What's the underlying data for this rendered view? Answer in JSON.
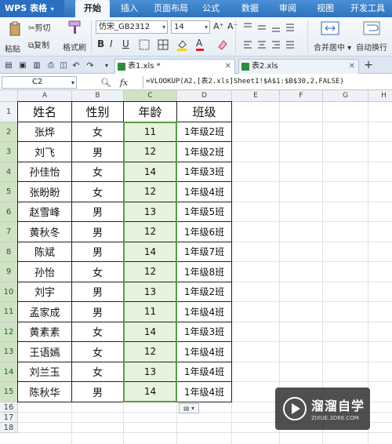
{
  "menubar": {
    "app_name": "WPS 表格",
    "tabs": [
      "开始",
      "插入",
      "页面布局",
      "公式",
      "数据",
      "审阅",
      "视图",
      "开发工具"
    ],
    "active_tab": "开始"
  },
  "ribbon": {
    "paste": "粘贴",
    "cut": "剪切",
    "copy": "复制",
    "format_painter": "格式刷",
    "font_name": "仿宋_GB2312",
    "font_size": "14",
    "bold": "B",
    "italic": "I",
    "underline": "U",
    "font_color": "A",
    "grow_font": "A⁺",
    "shrink_font": "A⁻",
    "merge_center": "合并居中",
    "wrap_text": "自动换行"
  },
  "file_tabs": [
    {
      "label": "表1.xls *",
      "active": true
    },
    {
      "label": "表2.xls",
      "active": false
    }
  ],
  "formula_bar": {
    "cell_ref": "C2",
    "fx": "fx",
    "formula": "=VLOOKUP(A2,[表2.xls]Sheet1!$A$1:$B$30,2,FALSE)"
  },
  "sheet": {
    "columns": [
      "A",
      "B",
      "C",
      "D",
      "E",
      "F",
      "G",
      "H"
    ],
    "rows": [
      "1",
      "2",
      "3",
      "4",
      "5",
      "6",
      "7",
      "8",
      "9",
      "10",
      "11",
      "12",
      "13",
      "14",
      "15",
      "16",
      "17",
      "18"
    ],
    "headers": [
      "姓名",
      "性别",
      "年龄",
      "班级"
    ],
    "data": [
      [
        "张烨",
        "女",
        "11",
        "1年级2班"
      ],
      [
        "刘飞",
        "男",
        "12",
        "1年级2班"
      ],
      [
        "孙佳怡",
        "女",
        "14",
        "1年级3班"
      ],
      [
        "张盼盼",
        "女",
        "12",
        "1年级4班"
      ],
      [
        "赵雪峰",
        "男",
        "13",
        "1年级5班"
      ],
      [
        "黄秋冬",
        "男",
        "12",
        "1年级6班"
      ],
      [
        "陈斌",
        "男",
        "14",
        "1年级7班"
      ],
      [
        "孙怡",
        "女",
        "12",
        "1年级8班"
      ],
      [
        "刘宇",
        "男",
        "13",
        "1年级2班"
      ],
      [
        "孟家成",
        "男",
        "11",
        "1年级4班"
      ],
      [
        "黄素素",
        "女",
        "14",
        "1年级3班"
      ],
      [
        "王语嫣",
        "女",
        "12",
        "1年级4班"
      ],
      [
        "刘兰玉",
        "女",
        "13",
        "1年级4班"
      ],
      [
        "陈秋华",
        "男",
        "14",
        "1年级4班"
      ]
    ],
    "selected_column": "C"
  },
  "watermark": {
    "title": "溜溜自学",
    "subtitle": "ZIXUE.3D66.COM"
  }
}
